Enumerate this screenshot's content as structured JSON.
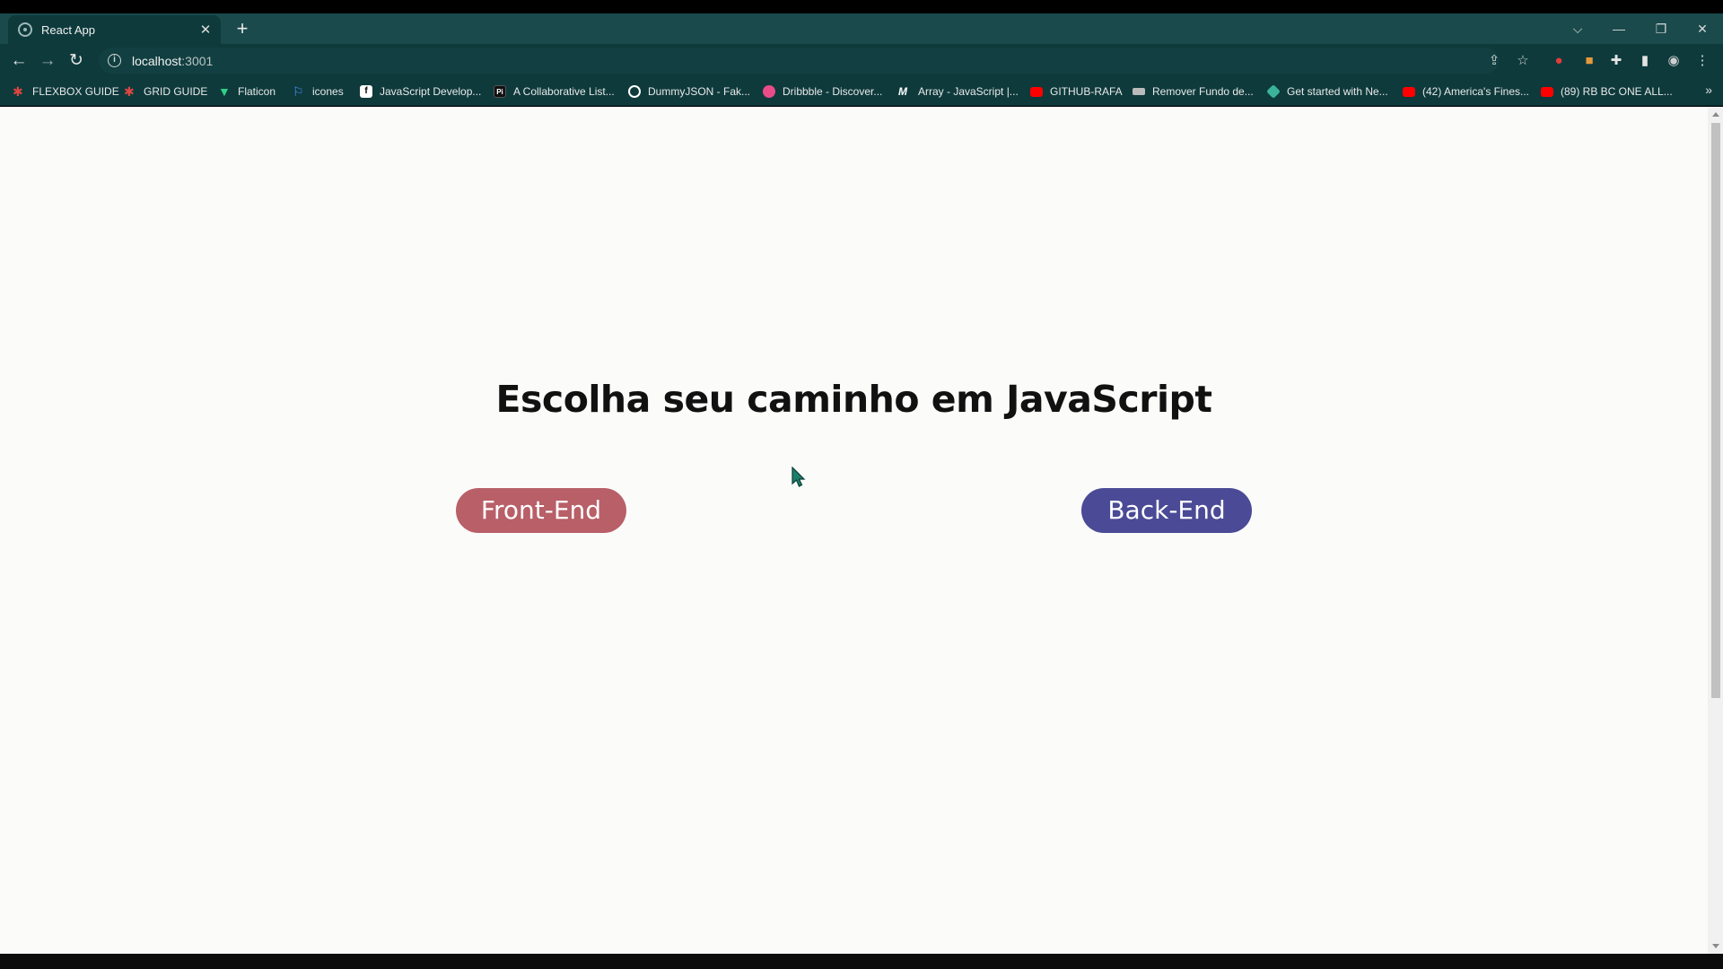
{
  "browser": {
    "tab_title": "React App",
    "tab_close": "✕",
    "new_tab": "+",
    "url_host": "localhost",
    "url_port": ":3001",
    "bookmarks": [
      {
        "label": "FLEXBOX GUIDE",
        "icon": "asterisk-icon",
        "color": "#e0463f"
      },
      {
        "label": "GRID GUIDE",
        "icon": "asterisk-icon",
        "color": "#e0463f"
      },
      {
        "label": "Flaticon",
        "icon": "flaticon-icon",
        "color": "#2fd18a"
      },
      {
        "label": "icones",
        "icon": "flag-icon",
        "color": "#4c8df6"
      },
      {
        "label": "JavaScript Develop...",
        "icon": "f-logo-icon",
        "color": "#ffffff"
      },
      {
        "label": "A Collaborative List...",
        "icon": "pi-logo-icon",
        "color": "#ffffff"
      },
      {
        "label": "DummyJSON - Fak...",
        "icon": "globe-icon",
        "color": "#ffffff"
      },
      {
        "label": "Dribbble - Discover...",
        "icon": "dribbble-icon",
        "color": "#ea4c89"
      },
      {
        "label": "Array - JavaScript |...",
        "icon": "mdn-icon",
        "color": "#ffffff"
      },
      {
        "label": "GITHUB-RAFA",
        "icon": "youtube-icon",
        "color": "#ff0000"
      },
      {
        "label": "Remover Fundo de...",
        "icon": "layers-icon",
        "color": "#bbbbbb"
      },
      {
        "label": "Get started with Ne...",
        "icon": "diamond-icon",
        "color": "#3bb39b"
      },
      {
        "label": "(42) America's Fines...",
        "icon": "youtube-icon",
        "color": "#ff0000"
      },
      {
        "label": "(89) RB BC ONE ALL...",
        "icon": "youtube-icon",
        "color": "#ff0000"
      }
    ]
  },
  "page": {
    "heading": "Escolha seu caminho em JavaScript",
    "front_button": "Front-End",
    "back_button": "Back-End"
  },
  "colors": {
    "front_button": "#b85f68",
    "back_button": "#4a4a96",
    "browser_frame": "#0e3a3c"
  }
}
